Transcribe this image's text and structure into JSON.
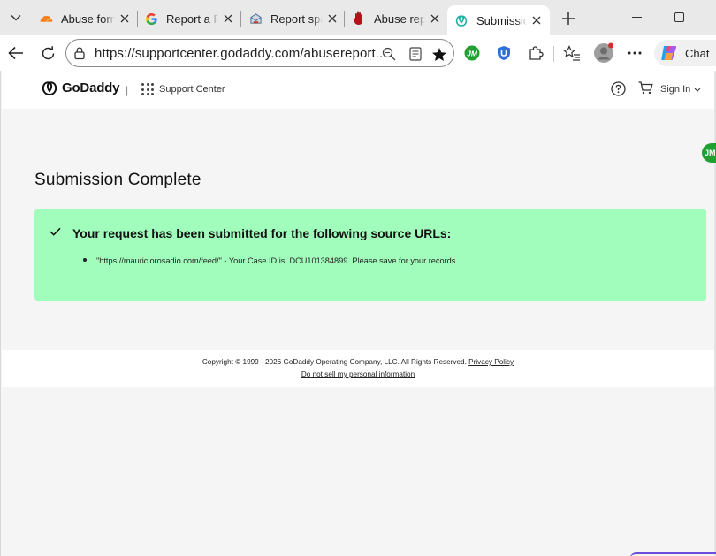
{
  "browser": {
    "tabs": [
      {
        "title": "Abuse form",
        "icon": "cloudflare-icon"
      },
      {
        "title": "Report a Pa",
        "icon": "google-icon"
      },
      {
        "title": "Report spar",
        "icon": "spam-report-icon"
      },
      {
        "title": "Abuse repo",
        "icon": "stop-hand-icon"
      },
      {
        "title": "Submission",
        "icon": "godaddy-icon",
        "active": true
      }
    ],
    "url": "https://supportcenter.godaddy.com/abusereport...",
    "chat_label": "Chat",
    "extension_label": "JM"
  },
  "header": {
    "logo_text": "GoDaddy",
    "separator": "|",
    "support_label": "Support Center",
    "signin_label": "Sign In"
  },
  "main": {
    "title": "Submission Complete",
    "alert_title": "Your request has been submitted for the following source URLs:",
    "items": [
      "\"https://mauriciorosadio.com/feed/\" - Your Case ID is: DCU101384899. Please save for your records."
    ]
  },
  "footer": {
    "copyright": "Copyright © 1999 - 2026 GoDaddy Operating Company, LLC. All Rights Reserved.",
    "privacy_label": "Privacy Policy",
    "dns_label": "Do not sell my personal information"
  },
  "side_badge": "JM",
  "colors": {
    "alert_bg": "#a1fdbb",
    "badge_green": "#1ea131",
    "tab_bar": "#e9e9e9"
  }
}
